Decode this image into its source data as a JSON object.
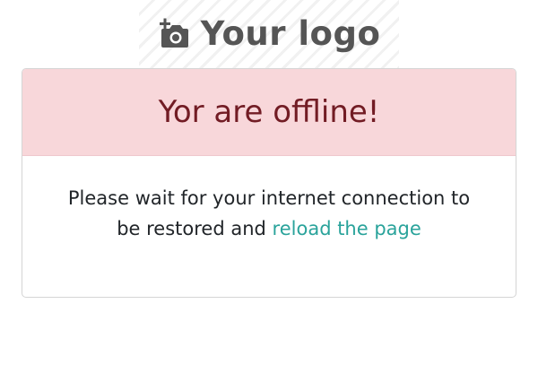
{
  "logo": {
    "text": "Your logo",
    "icon": "add-photo-icon"
  },
  "alert": {
    "title": "Yor are offline!",
    "message_part1": "Please wait for your internet connection to be restored and",
    "link_text": "reload the page"
  },
  "colors": {
    "header_bg": "#f8d7da",
    "title": "#721c24",
    "link": "#2aa39b",
    "logo": "#555555"
  }
}
